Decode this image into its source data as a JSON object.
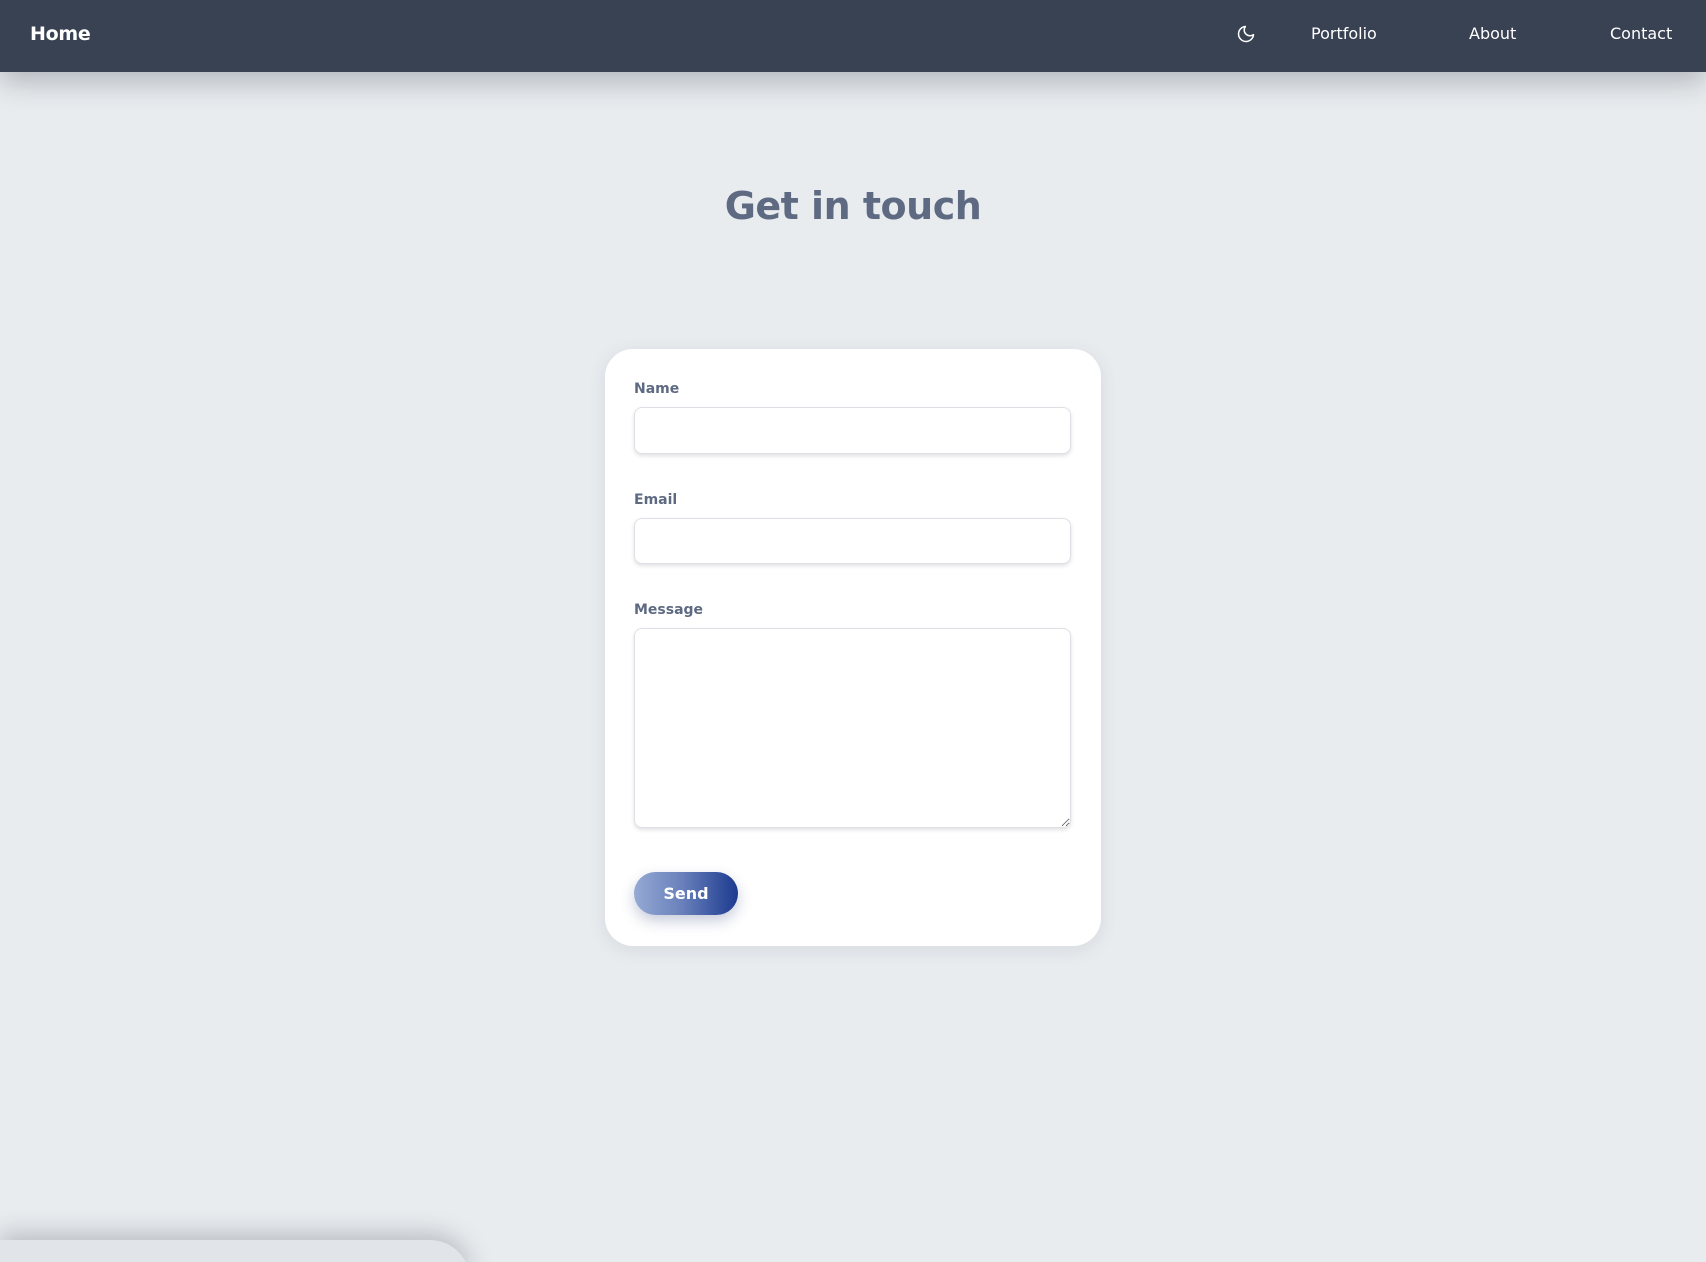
{
  "nav": {
    "home_label": "Home",
    "theme_icon": "moon-icon",
    "links": [
      {
        "label": "Portfolio"
      },
      {
        "label": "About"
      },
      {
        "label": "Contact"
      }
    ]
  },
  "page": {
    "title": "Get in touch"
  },
  "form": {
    "name_label": "Name",
    "name_value": "",
    "email_label": "Email",
    "email_value": "",
    "message_label": "Message",
    "message_value": "",
    "submit_label": "Send"
  },
  "colors": {
    "navbar_bg": "#394253",
    "page_bg": "#e8ecef",
    "title_text": "#5e6a82",
    "button_gradient_start": "#95a9d4",
    "button_gradient_end": "#1c3a8f"
  }
}
